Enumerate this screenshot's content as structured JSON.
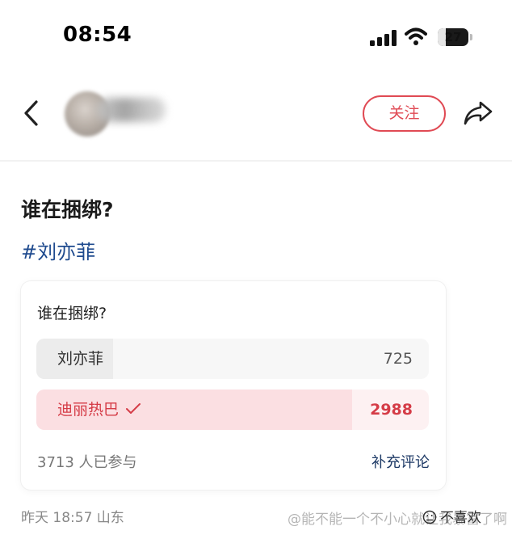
{
  "status_bar": {
    "time": "08:54",
    "battery_level": "27",
    "battery_fraction": 0.27
  },
  "nav": {
    "follow_label": "关注"
  },
  "post": {
    "title": "谁在捆绑?",
    "hashtag": "#刘亦菲",
    "meta": "昨天 18:57 山东",
    "dislike_label": "不喜欢"
  },
  "poll": {
    "question": "谁在捆绑?",
    "options": [
      {
        "label": "刘亦菲",
        "count": "725",
        "share": 0.195,
        "selected": false
      },
      {
        "label": "迪丽热巴",
        "count": "2988",
        "share": 0.805,
        "selected": true
      }
    ],
    "participants": "3713 人已参与",
    "add_comment_label": "补充评论"
  },
  "colors": {
    "accent_red": "#e04a54",
    "hashtag_blue": "#1e4a8e",
    "selected_fill": "#fbdfe2"
  },
  "watermark": "@能不能一个不小心就让我暴富了啊"
}
